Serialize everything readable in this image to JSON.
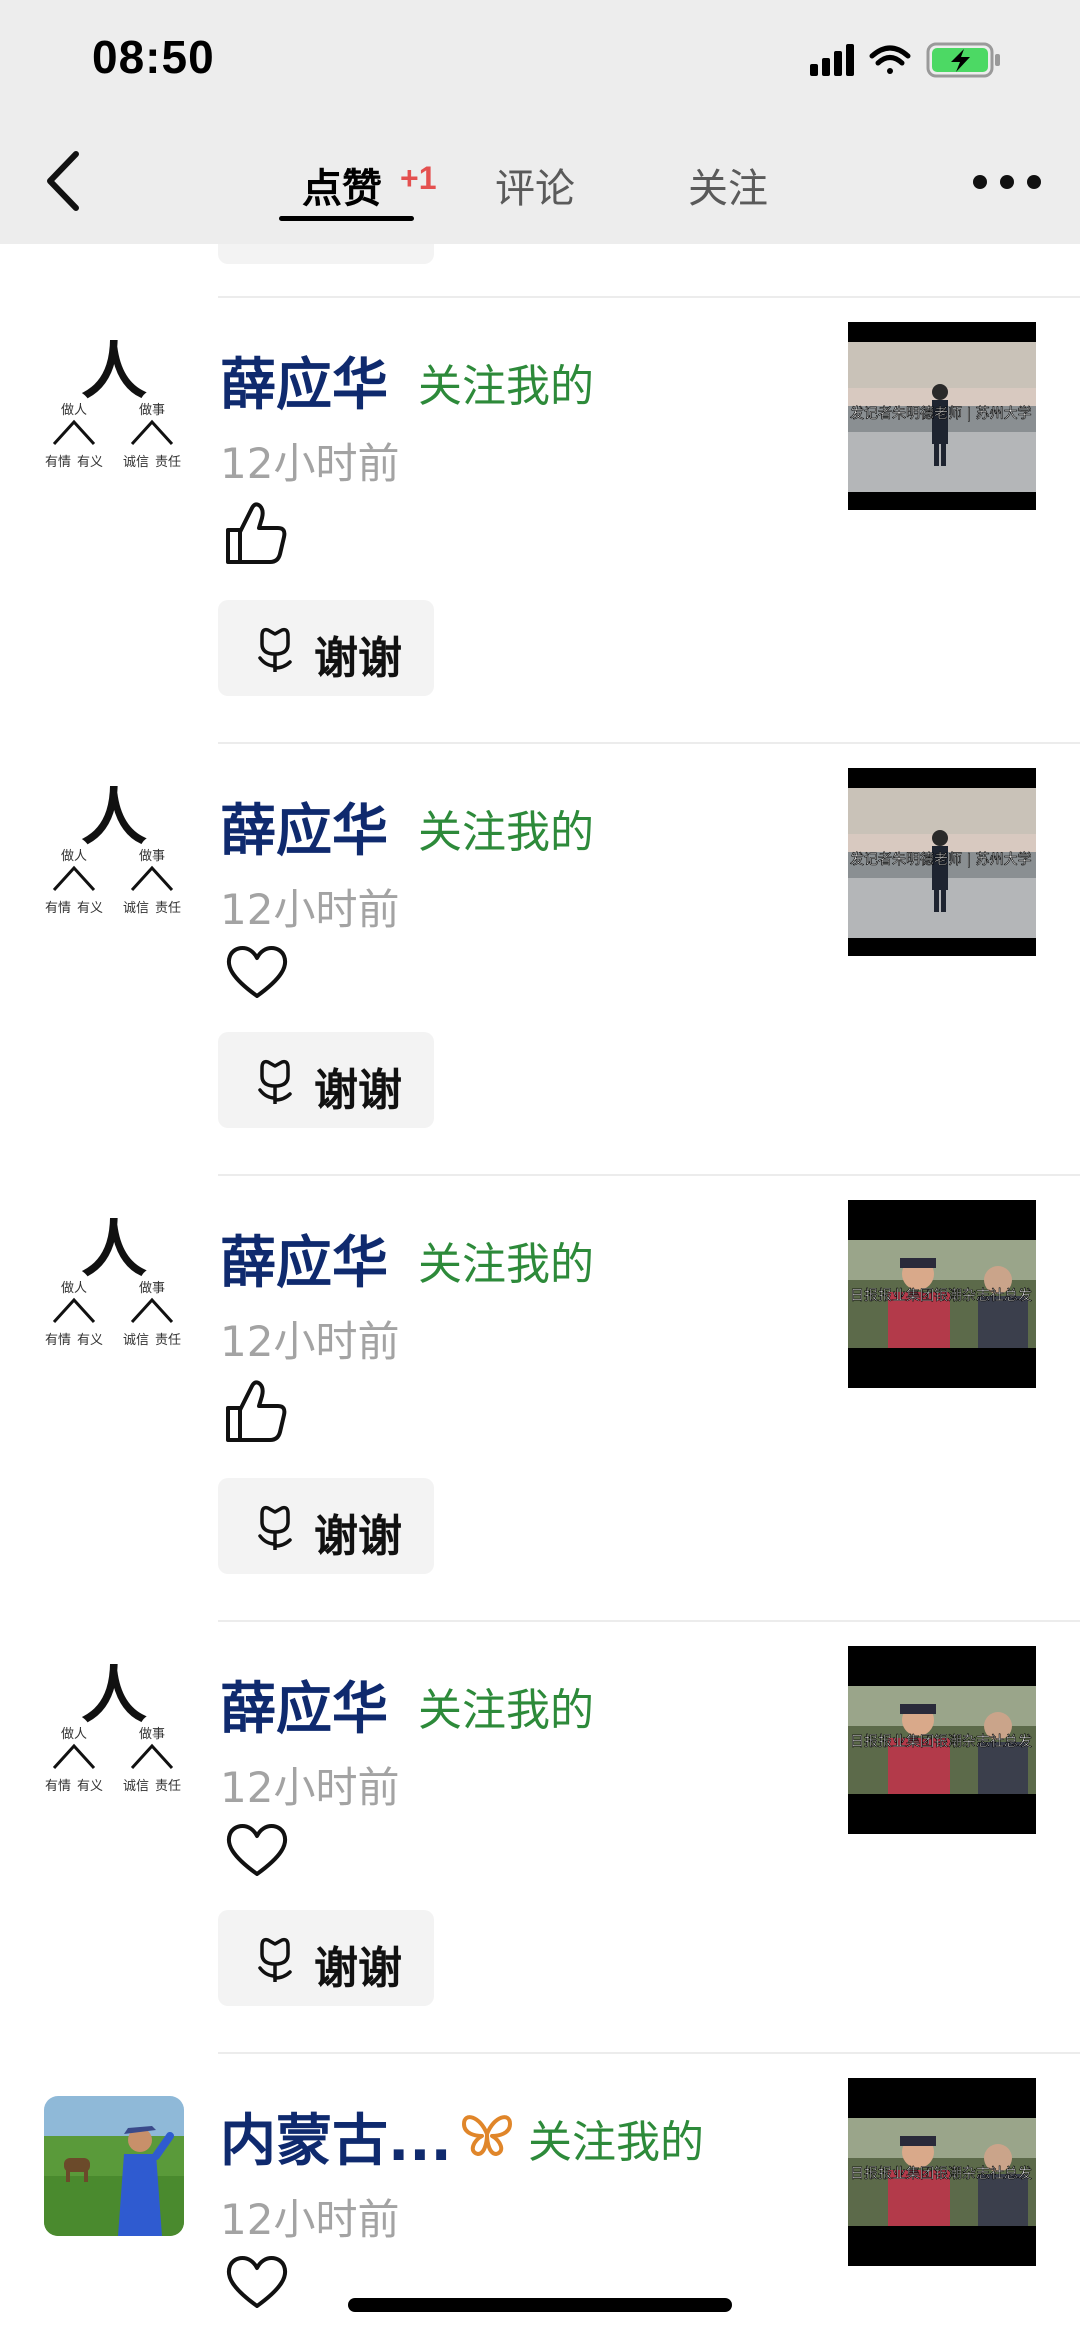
{
  "status_bar": {
    "time": "08:50"
  },
  "nav": {
    "tabs": [
      {
        "label": "点赞",
        "badge": "+1",
        "active": true
      },
      {
        "label": "评论"
      },
      {
        "label": "关注"
      }
    ]
  },
  "avatar_caption": {
    "top_glyph": "人",
    "left_head": "做人",
    "right_head": "做事",
    "leaves": [
      "有情",
      "有义",
      "诚信",
      "责任"
    ]
  },
  "thumb_captions": {
    "clip_a": "发记者朱明德老师 | 苏州大学",
    "clip_b": "日报报业集团银潮杂志社总发"
  },
  "items": [
    {
      "user": "薛应华",
      "note": "关注我的",
      "time": "12小时前",
      "reaction": "thumbs-up",
      "thanks": "谢谢"
    },
    {
      "user": "薛应华",
      "note": "关注我的",
      "time": "12小时前",
      "reaction": "heart",
      "thanks": "谢谢"
    },
    {
      "user": "薛应华",
      "note": "关注我的",
      "time": "12小时前",
      "reaction": "thumbs-up",
      "thanks": "谢谢"
    },
    {
      "user": "薛应华",
      "note": "关注我的",
      "time": "12小时前",
      "reaction": "heart",
      "thanks": "谢谢"
    },
    {
      "user": "内蒙古...",
      "note": "关注我的",
      "time": "12小时前",
      "reaction": "heart"
    }
  ],
  "colors": {
    "name": "#0f2a6e",
    "note": "#2d8a3a",
    "badge": "#e4504f",
    "battery": "#4cd964"
  }
}
